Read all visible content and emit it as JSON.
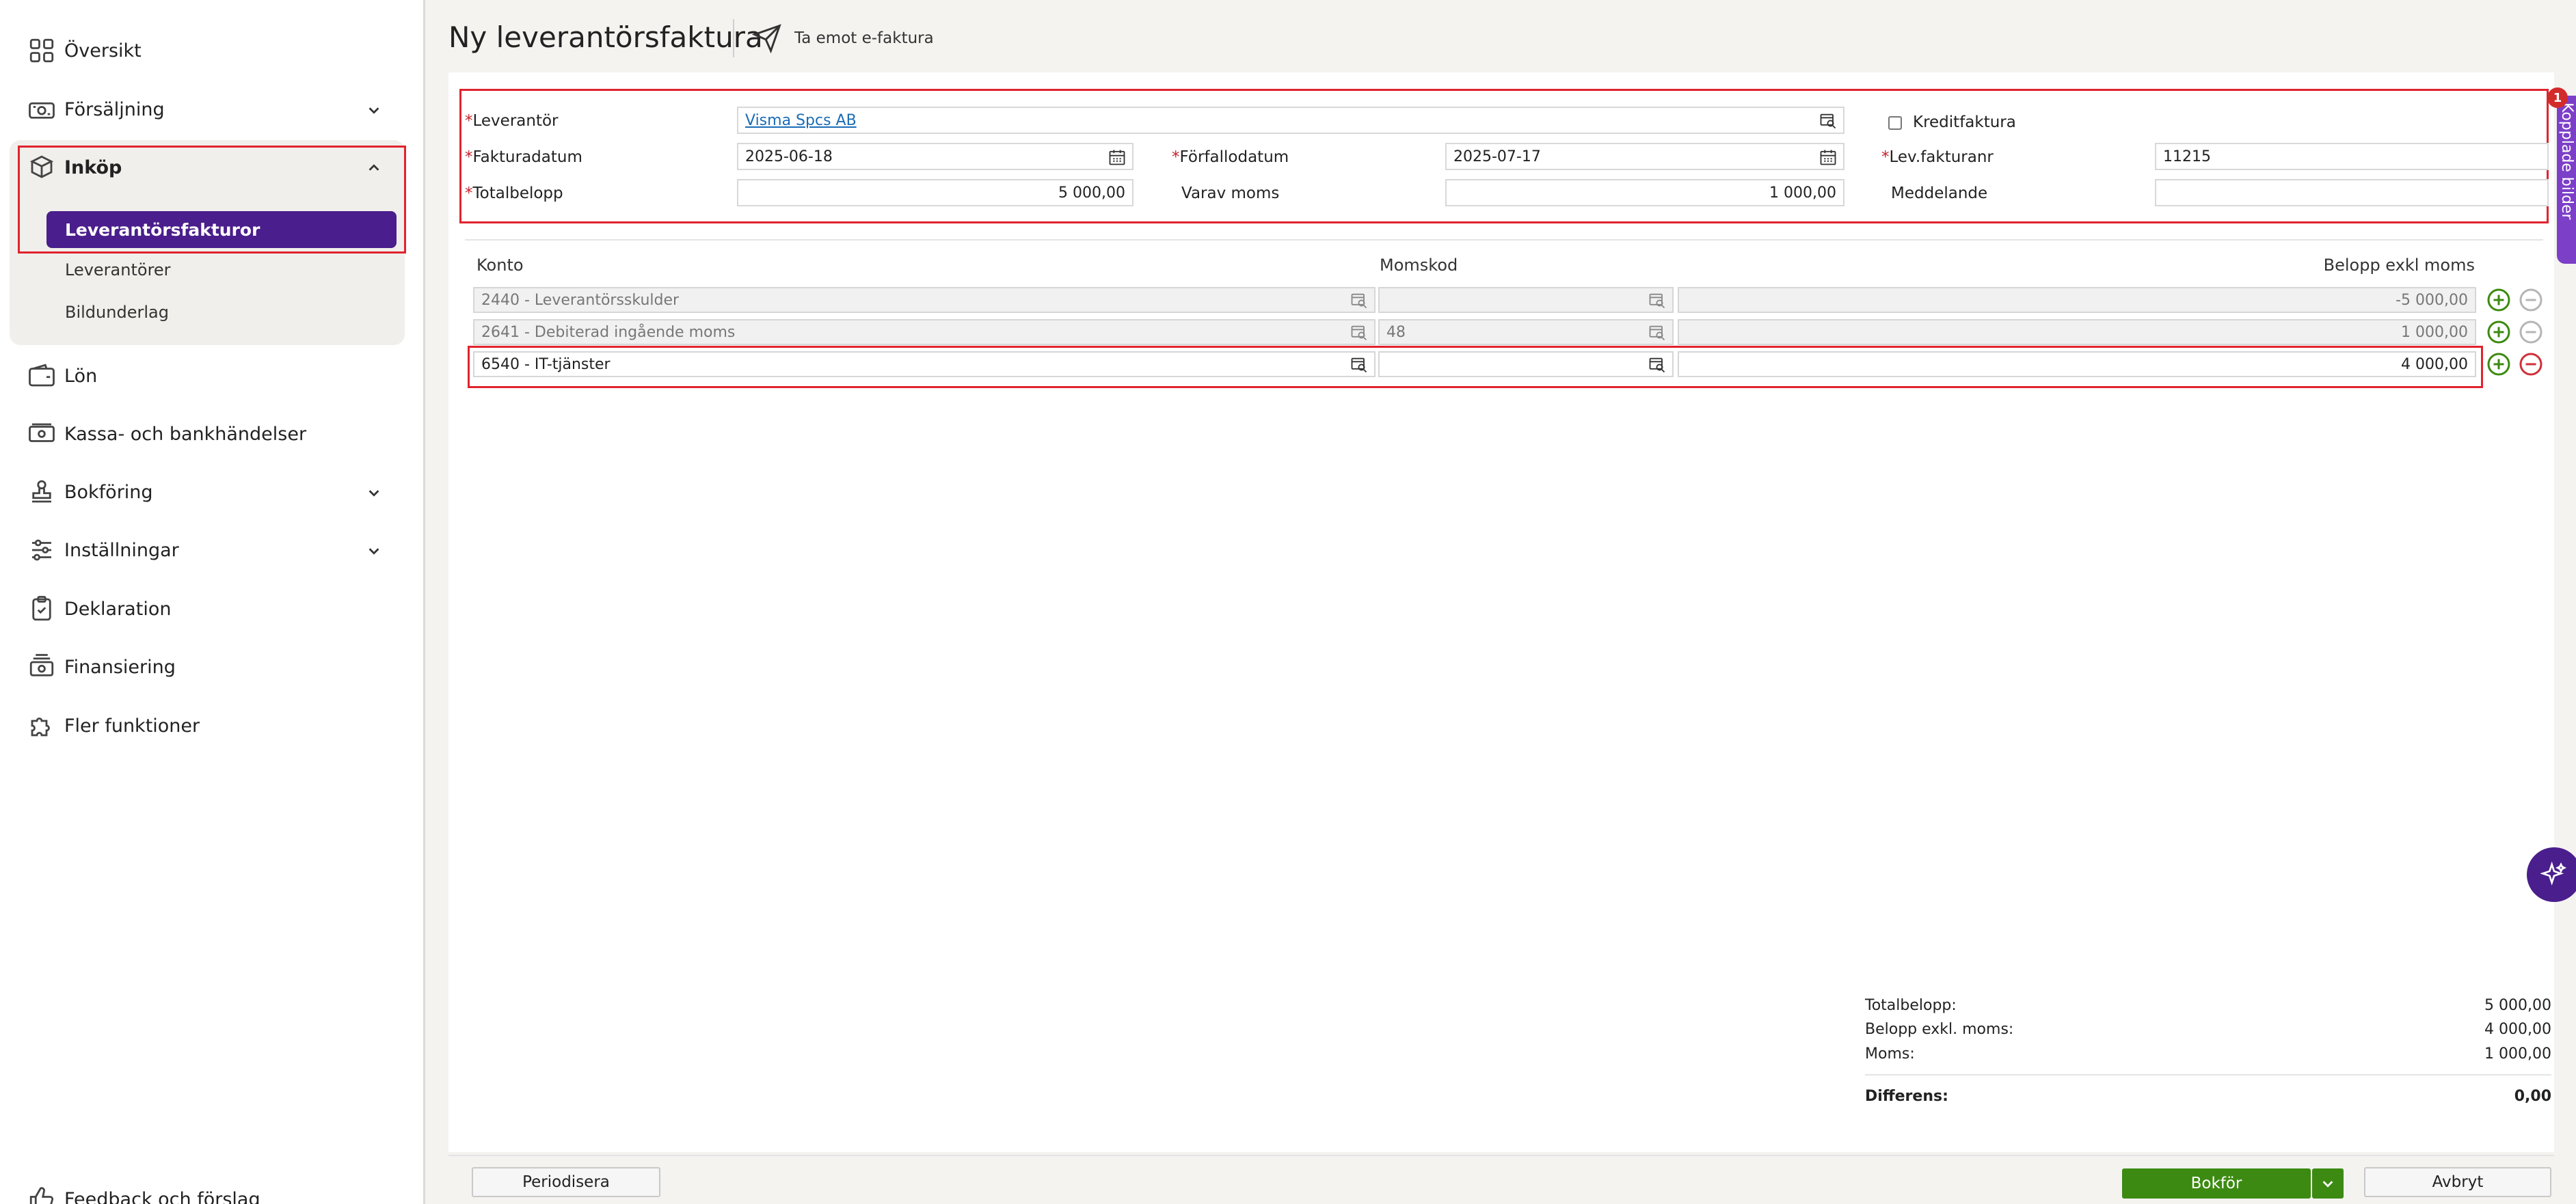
{
  "sidebar": {
    "items": [
      {
        "label": "Översikt",
        "icon": "grid-icon"
      },
      {
        "label": "Försäljning",
        "icon": "cash-register-icon"
      },
      {
        "label": "Inköp",
        "icon": "boxes-icon"
      },
      {
        "label": "Lön",
        "icon": "wallet-icon"
      },
      {
        "label": "Kassa- och bankhändelser",
        "icon": "money-icon"
      },
      {
        "label": "Bokföring",
        "icon": "stamp-icon"
      },
      {
        "label": "Inställningar",
        "icon": "sliders-icon"
      },
      {
        "label": "Deklaration",
        "icon": "clipboard-icon"
      },
      {
        "label": "Finansiering",
        "icon": "cash-stack-icon"
      },
      {
        "label": "Fler funktioner",
        "icon": "puzzle-icon"
      }
    ],
    "inkop_sub": [
      "Leverantörsfakturor",
      "Leverantörer",
      "Bildunderlag"
    ],
    "feedback": "Feedback och förslag"
  },
  "header": {
    "title": "Ny leverantörsfaktura",
    "efaktura": "Ta emot e-faktura"
  },
  "form": {
    "leverantor_label": "Leverantör",
    "leverantor_value": "Visma Spcs AB",
    "kreditfaktura_label": "Kreditfaktura",
    "fakturadatum_label": "Fakturadatum",
    "fakturadatum_value": "2025-06-18",
    "forfallodatum_label": "Förfallodatum",
    "forfallodatum_value": "2025-07-17",
    "levfakturanr_label": "Lev.fakturanr",
    "levfakturanr_value": "11215",
    "totalbelopp_label": "Totalbelopp",
    "totalbelopp_value": "5 000,00",
    "varavmoms_label": "Varav moms",
    "varavmoms_value": "1 000,00",
    "meddelande_label": "Meddelande",
    "meddelande_value": "",
    "required_mark": "*"
  },
  "table": {
    "headers": [
      "Konto",
      "Momskod",
      "Belopp exkl moms"
    ],
    "rows": [
      {
        "konto": "2440 - Leverantörsskulder",
        "momskod": "",
        "belopp": "-5 000,00"
      },
      {
        "konto": "2641 - Debiterad ingående moms",
        "momskod": "48",
        "belopp": "1 000,00"
      },
      {
        "konto": "6540 - IT-tjänster",
        "momskod": "",
        "belopp": "4 000,00"
      }
    ]
  },
  "summary": {
    "totalbelopp_label": "Totalbelopp:",
    "totalbelopp_value": "5 000,00",
    "exkl_label": "Belopp exkl. moms:",
    "exkl_value": "4 000,00",
    "moms_label": "Moms:",
    "moms_value": "1 000,00",
    "diff_label": "Differens:",
    "diff_value": "0,00"
  },
  "footer": {
    "periodisera": "Periodisera",
    "bokfor": "Bokför",
    "avbryt": "Avbryt"
  },
  "side_tab": {
    "label": "Kopplade bilder",
    "badge": "1"
  },
  "colors": {
    "brand_purple": "#4a1e8c",
    "accent_purple": "#7c3fc7",
    "highlight_red": "#e0232e",
    "primary_green": "#3c8a12",
    "link_blue": "#1b6cb5"
  }
}
